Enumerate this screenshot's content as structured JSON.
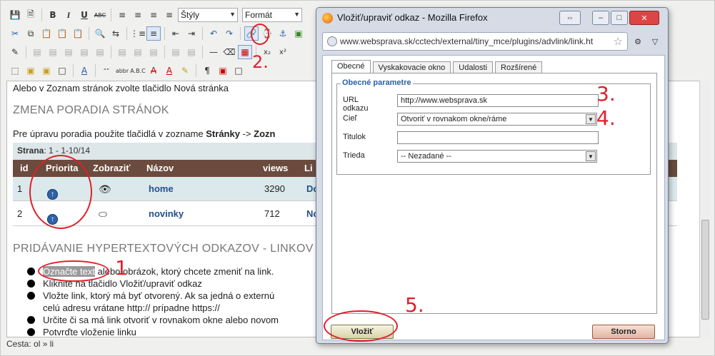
{
  "toolbar": {
    "styles_select": "Štýly",
    "format_select": "Formát",
    "bold": "B",
    "italic": "I",
    "underline": "U",
    "strike": "ABC"
  },
  "content": {
    "intro": "Alebo v Zoznam stránok zvolte tlačidlo Nová stránka",
    "heading_order": "ZMENA PORADIA STRÁNOK",
    "reorder_text_a": "Pre úpravu poradia použite tlačidlá v zozname ",
    "reorder_text_b": "Stránky",
    "reorder_text_c": " -> ",
    "reorder_text_d": "Zozn",
    "pager_label": "Strana",
    "pager_value": ": 1  -  1-10/14",
    "table": {
      "headers": [
        "id",
        "Priorita",
        "Zobraziť",
        "Názov",
        "views",
        "Li"
      ],
      "rows": [
        {
          "id": "1",
          "name": "home",
          "views": "3290",
          "link": "Do"
        },
        {
          "id": "2",
          "name": "novinky",
          "views": "712",
          "link": "Nov"
        }
      ]
    },
    "heading_links": "PRIDÁVANIE HYPERTEXTOVÝCH ODKAZOV - LINKOV",
    "bullets": [
      {
        "pre_highlight": "Označte text",
        "rest": " alebo obrázok, ktorý chcete zmeniť na link."
      },
      {
        "text": "Kliknite na tlačidlo Vložiť/upraviť odkaz"
      },
      {
        "text": "Vložte link, ktorý má byť otvorený. Ak sa jedná o externú"
      },
      {
        "text": "celú adresu vrátane http:// prípadne https://",
        "continuation": true
      },
      {
        "text": "Určite či sa má link otvoriť v rovnakom okne alebo novom"
      },
      {
        "text": "Potvrďte vloženie linku"
      }
    ],
    "status_path": "Cesta: ol » li"
  },
  "dialog": {
    "title": "Vložiť/upraviť odkaz - Mozilla Firefox",
    "url": "www.websprava.sk/cctech/external/tiny_mce/plugins/advlink/link.ht",
    "tabs": [
      "Obecné",
      "Vyskakovacie okno",
      "Udalosti",
      "Rozšírené"
    ],
    "legend": "Obecné parametre",
    "fields": {
      "url_label": "URL odkazu",
      "url_value": "http://www.websprava.sk",
      "target_label": "Cieľ",
      "target_value": "Otvoriť v rovnakom okne/ráme",
      "title_label": "Titulok",
      "title_value": "",
      "class_label": "Trieda",
      "class_value": "-- Nezadané --"
    },
    "insert_label": "Vložiť",
    "cancel_label": "Storno"
  },
  "annotations": [
    "1",
    "2.",
    "3.",
    "4.",
    "5."
  ]
}
